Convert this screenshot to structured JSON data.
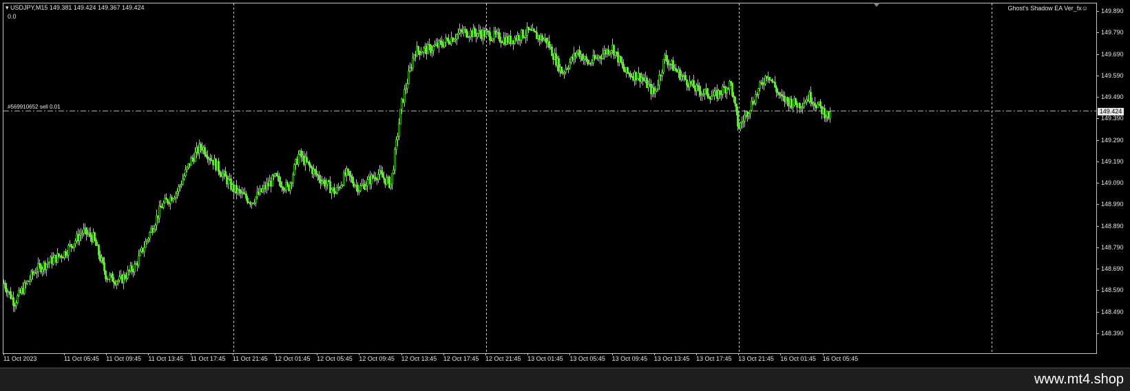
{
  "header": {
    "symbol_line": "▾ USDJPY,M15  149.381 149.424 149.367 149.424",
    "sub_value": "0.0",
    "ea_name": "Ghost's Shadow EA Ver_fx☺"
  },
  "order": {
    "label": "#569910652 sell 0.01",
    "price": "149.424"
  },
  "colors": {
    "background": "#000000",
    "candle": "#66ff33",
    "grid": "#c8c8c8",
    "order_line": "#b0b0b0"
  },
  "watermark": "www.mt4.shop",
  "chart_data": {
    "type": "candlestick",
    "symbol": "USDJPY",
    "timeframe": "M15",
    "price_ticks": [
      "149.890",
      "149.790",
      "149.690",
      "149.590",
      "149.490",
      "149.390",
      "149.290",
      "149.190",
      "149.090",
      "148.990",
      "148.890",
      "148.790",
      "148.690",
      "148.590",
      "148.490",
      "148.390"
    ],
    "time_ticks": [
      "11 Oct 2023",
      "11 Oct 05:45",
      "11 Oct 09:45",
      "11 Oct 13:45",
      "11 Oct 17:45",
      "11 Oct 21:45",
      "12 Oct 01:45",
      "12 Oct 05:45",
      "12 Oct 09:45",
      "12 Oct 13:45",
      "12 Oct 17:45",
      "12 Oct 21:45",
      "13 Oct 01:45",
      "13 Oct 05:45",
      "13 Oct 09:45",
      "13 Oct 13:45",
      "13 Oct 17:45",
      "13 Oct 21:45",
      "16 Oct 01:45",
      "16 Oct 05:45"
    ],
    "ylim": [
      148.37,
      149.9
    ],
    "day_separators": [
      "12 Oct",
      "13 Oct",
      "16 Oct",
      "17 Oct"
    ],
    "order_line_price": 149.424,
    "close_path": [
      [
        "11 Oct 2023",
        148.62
      ],
      [
        "11 Oct 01:00",
        148.53
      ],
      [
        "11 Oct 03:00",
        148.68
      ],
      [
        "11 Oct 05:45",
        148.76
      ],
      [
        "11 Oct 07:30",
        148.86
      ],
      [
        "11 Oct 08:30",
        148.83
      ],
      [
        "11 Oct 09:45",
        148.65
      ],
      [
        "11 Oct 11:00",
        148.63
      ],
      [
        "11 Oct 12:30",
        148.7
      ],
      [
        "11 Oct 13:45",
        148.84
      ],
      [
        "11 Oct 15:00",
        148.98
      ],
      [
        "11 Oct 16:30",
        149.05
      ],
      [
        "11 Oct 17:45",
        149.19
      ],
      [
        "11 Oct 18:45",
        149.26
      ],
      [
        "11 Oct 20:00",
        149.18
      ],
      [
        "11 Oct 21:45",
        149.06
      ],
      [
        "11 Oct 23:30",
        149.0
      ],
      [
        "12 Oct 01:45",
        149.11
      ],
      [
        "12 Oct 03:00",
        149.06
      ],
      [
        "12 Oct 04:00",
        149.22
      ],
      [
        "12 Oct 05:45",
        149.12
      ],
      [
        "12 Oct 07:30",
        149.04
      ],
      [
        "12 Oct 08:30",
        149.13
      ],
      [
        "12 Oct 09:45",
        149.06
      ],
      [
        "12 Oct 11:30",
        149.13
      ],
      [
        "12 Oct 12:45",
        149.08
      ],
      [
        "12 Oct 13:45",
        149.45
      ],
      [
        "12 Oct 15:00",
        149.7
      ],
      [
        "12 Oct 16:30",
        149.71
      ],
      [
        "12 Oct 17:45",
        149.74
      ],
      [
        "12 Oct 19:30",
        149.79
      ],
      [
        "12 Oct 21:45",
        149.78
      ],
      [
        "13 Oct 00:00",
        149.75
      ],
      [
        "13 Oct 01:45",
        149.79
      ],
      [
        "13 Oct 03:30",
        149.75
      ],
      [
        "13 Oct 05:00",
        149.6
      ],
      [
        "13 Oct 06:30",
        149.7
      ],
      [
        "13 Oct 07:30",
        149.64
      ],
      [
        "13 Oct 09:45",
        149.72
      ],
      [
        "13 Oct 11:00",
        149.6
      ],
      [
        "13 Oct 12:30",
        149.58
      ],
      [
        "13 Oct 13:45",
        149.5
      ],
      [
        "13 Oct 14:45",
        149.67
      ],
      [
        "13 Oct 16:00",
        149.6
      ],
      [
        "13 Oct 17:45",
        149.52
      ],
      [
        "13 Oct 19:30",
        149.49
      ],
      [
        "13 Oct 21:00",
        149.55
      ],
      [
        "13 Oct 21:45",
        149.34
      ],
      [
        "16 Oct 00:30",
        149.6
      ],
      [
        "16 Oct 01:45",
        149.48
      ],
      [
        "16 Oct 03:30",
        149.45
      ],
      [
        "16 Oct 04:30",
        149.49
      ],
      [
        "16 Oct 05:45",
        149.42
      ],
      [
        "16 Oct 06:30",
        149.39
      ]
    ]
  }
}
